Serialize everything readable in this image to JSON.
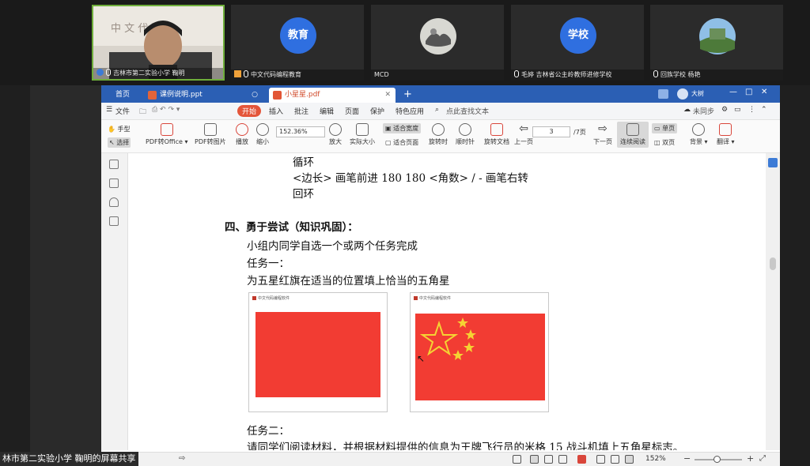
{
  "participants": [
    {
      "name": "吉林市第二实验小学 鞠明",
      "active": true
    },
    {
      "name": "中文代码编程教育",
      "avatar_text": "教育",
      "avatar_color": "#2f6fe0"
    },
    {
      "name": "MCD"
    },
    {
      "name": "毛婷 吉林省公主岭教师进修学校",
      "avatar_text": "学校",
      "avatar_color": "#2f6fe0"
    },
    {
      "name": "回族学校 杨艳"
    }
  ],
  "app": {
    "tabs": [
      {
        "label": "首页"
      },
      {
        "label": "课例说明.ppt"
      },
      {
        "label": "小星星.pdf",
        "selected": true
      }
    ],
    "user_name": "大树",
    "menu": {
      "file": "文件",
      "items": [
        "开始",
        "插入",
        "批注",
        "编辑",
        "页面",
        "保护",
        "特色应用"
      ],
      "search": "点此查找文本",
      "sync": "未同步"
    },
    "toolbar": {
      "hand": "手型",
      "select": "选择",
      "pdf_office": "PDF转Office",
      "pdf_image": "PDF转图片",
      "play": "播放",
      "zoom_out": "缩小",
      "zoom_value": "152.36%",
      "zoom_in": "放大",
      "actual_size": "实际大小",
      "fit_width": "适合宽度",
      "fit_page": "适合页面",
      "rotate_ccw": "旋转时",
      "rotate_cw": "顺时针",
      "rotate_doc": "旋转文档",
      "prev_page": "上一页",
      "page_current": "3",
      "page_total": "/7页",
      "next_page": "下一页",
      "continuous": "连续阅读",
      "single": "单页",
      "double": "双页",
      "background": "背景",
      "annotate": "翻译"
    }
  },
  "document": {
    "line_loop": "循环",
    "line_code": "<边长>  画笔前进  180 180 <角数> / -  画笔右转",
    "line_back": "回环",
    "section_title": "四、勇于尝试（知识巩固）：",
    "para1": "小组内同学自选一个或两个任务完成",
    "task1": "任务一：",
    "task1_desc": "为五星红旗在适当的位置填上恰当的五角星",
    "shot_title": "中文代码编程软件",
    "task2": "任务二：",
    "task2_desc": "请同学们阅读材料，并根据材料提供的信息为王牌飞行员的米格 15 战斗机填上五角星标志。"
  },
  "status": {
    "zoom": "152%",
    "share_label": "林市第二实验小学 鞠明的屏幕共享"
  }
}
